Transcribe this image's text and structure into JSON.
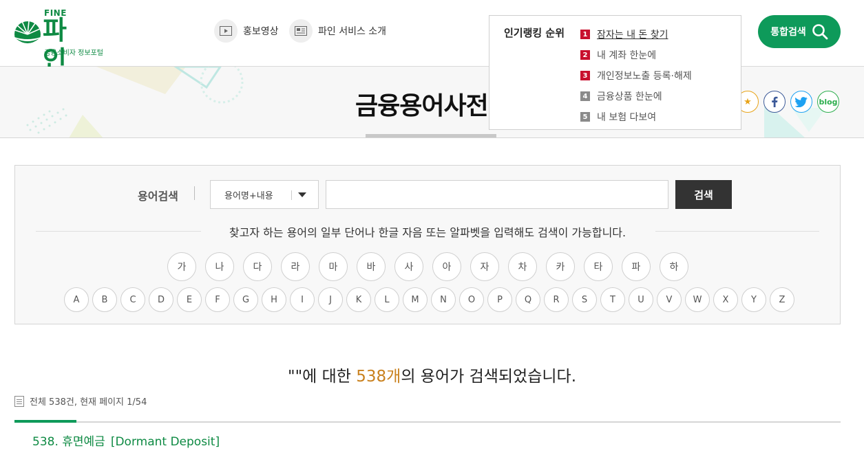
{
  "header": {
    "logo": {
      "top": "FINE",
      "name": "파 인",
      "sub": "금융소비자 정보포털"
    },
    "links": [
      {
        "label": "홍보영상",
        "icon": "play-icon"
      },
      {
        "label": "파인 서비스 소개",
        "icon": "newspaper-icon"
      }
    ],
    "ranking": {
      "title": "인기랭킹 순위",
      "items": [
        {
          "num": "1",
          "label": "잠자는 내 돈 찾기",
          "color": "#c8102e"
        },
        {
          "num": "2",
          "label": "내 계좌 한눈에",
          "color": "#c8102e"
        },
        {
          "num": "3",
          "label": "개인정보노출 등록·해제",
          "color": "#c8102e"
        },
        {
          "num": "4",
          "label": "금융상품 한눈에",
          "color": "#8a8a8a"
        },
        {
          "num": "5",
          "label": "내 보험 다보여",
          "color": "#8a8a8a"
        }
      ]
    },
    "search_button": "통합검색"
  },
  "banner": {
    "title": "금융용어사전",
    "share": [
      "bookmark-star-icon",
      "facebook-icon",
      "twitter-icon",
      "blog-icon"
    ],
    "blog_label": "blog"
  },
  "search": {
    "label": "용어검색",
    "select_value": "용어명+내용",
    "input_value": "",
    "button": "검색",
    "hint": "찾고자 하는 용어의 일부 단어나 한글 자음 또는 알파벳을 입력해도 검색이 가능합니다.",
    "korean": [
      "가",
      "나",
      "다",
      "라",
      "마",
      "바",
      "사",
      "아",
      "자",
      "차",
      "카",
      "타",
      "파",
      "하"
    ],
    "alphabet": [
      "A",
      "B",
      "C",
      "D",
      "E",
      "F",
      "G",
      "H",
      "I",
      "J",
      "K",
      "L",
      "M",
      "N",
      "O",
      "P",
      "Q",
      "R",
      "S",
      "T",
      "U",
      "V",
      "W",
      "X",
      "Y",
      "Z"
    ]
  },
  "results": {
    "heading_prefix": "\"\"에 대한 ",
    "count": "538개",
    "heading_suffix": "의 용어가 검색되었습니다.",
    "meta": "전체 538건, 현재 페이지 1/54",
    "first_item": {
      "title": "538. 휴면예금",
      "english": "[Dormant Deposit]"
    }
  },
  "colors": {
    "brand": "#0e8a43",
    "accent": "#0e9a5a",
    "count": "#c9811e",
    "rank_hot": "#c8102e"
  }
}
